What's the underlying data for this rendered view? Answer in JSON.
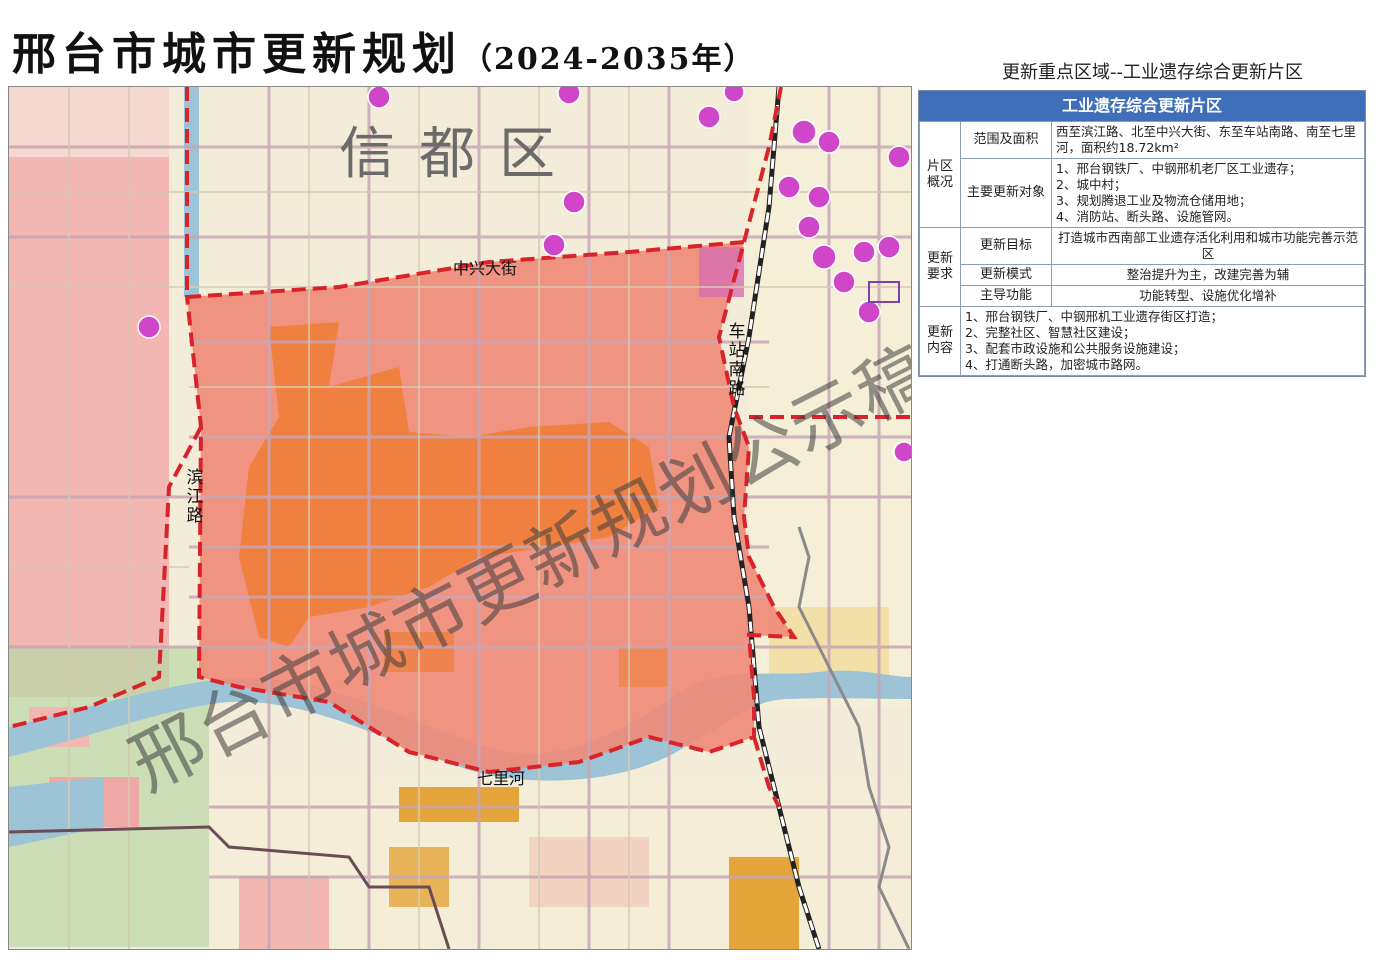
{
  "header": {
    "title": "邢台市城市更新规划",
    "years": "（2024-2035年）",
    "subtitle": "更新重点区域--工业遗存综合更新片区"
  },
  "map": {
    "district_label": "信都区",
    "watermark": "邢台市城市更新规划公示稿",
    "roads": {
      "zhongxing": "中兴大街",
      "binjiang": "滨江路",
      "chezhan": "车站南路",
      "qilihe": "七里河"
    },
    "colors": {
      "boundary": "#d9232a",
      "zone_fill": "#f08a78",
      "industrial": "#ef7e3a",
      "river": "#9cc3d6",
      "poi": "#d046c8"
    }
  },
  "panel": {
    "title": "工业遗存综合更新片区",
    "groups": [
      {
        "name": "片区概况",
        "rows": [
          {
            "key": "范围及面积",
            "value": "西至滨江路、北至中兴大街、东至车站南路、南至七里河，面积约18.72km²"
          },
          {
            "key": "主要更新对象",
            "value": "1、邢台钢铁厂、中钢邢机老厂区工业遗存；\n2、城中村；\n3、规划腾退工业及物流仓储用地；\n4、消防站、断头路、设施管网。"
          }
        ]
      },
      {
        "name": "更新要求",
        "rows": [
          {
            "key": "更新目标",
            "value": "打造城市西南部工业遗存活化利用和城市功能完善示范区"
          },
          {
            "key": "更新模式",
            "value": "整治提升为主，改建完善为辅"
          },
          {
            "key": "主导功能",
            "value": "功能转型、设施优化增补"
          }
        ]
      },
      {
        "name": "更新内容",
        "value": "1、邢台钢铁厂、中钢邢机工业遗存街区打造；\n2、完整社区、智慧社区建设；\n3、配套市政设施和公共服务设施建设；\n4、打通断头路，加密城市路网。"
      }
    ]
  }
}
